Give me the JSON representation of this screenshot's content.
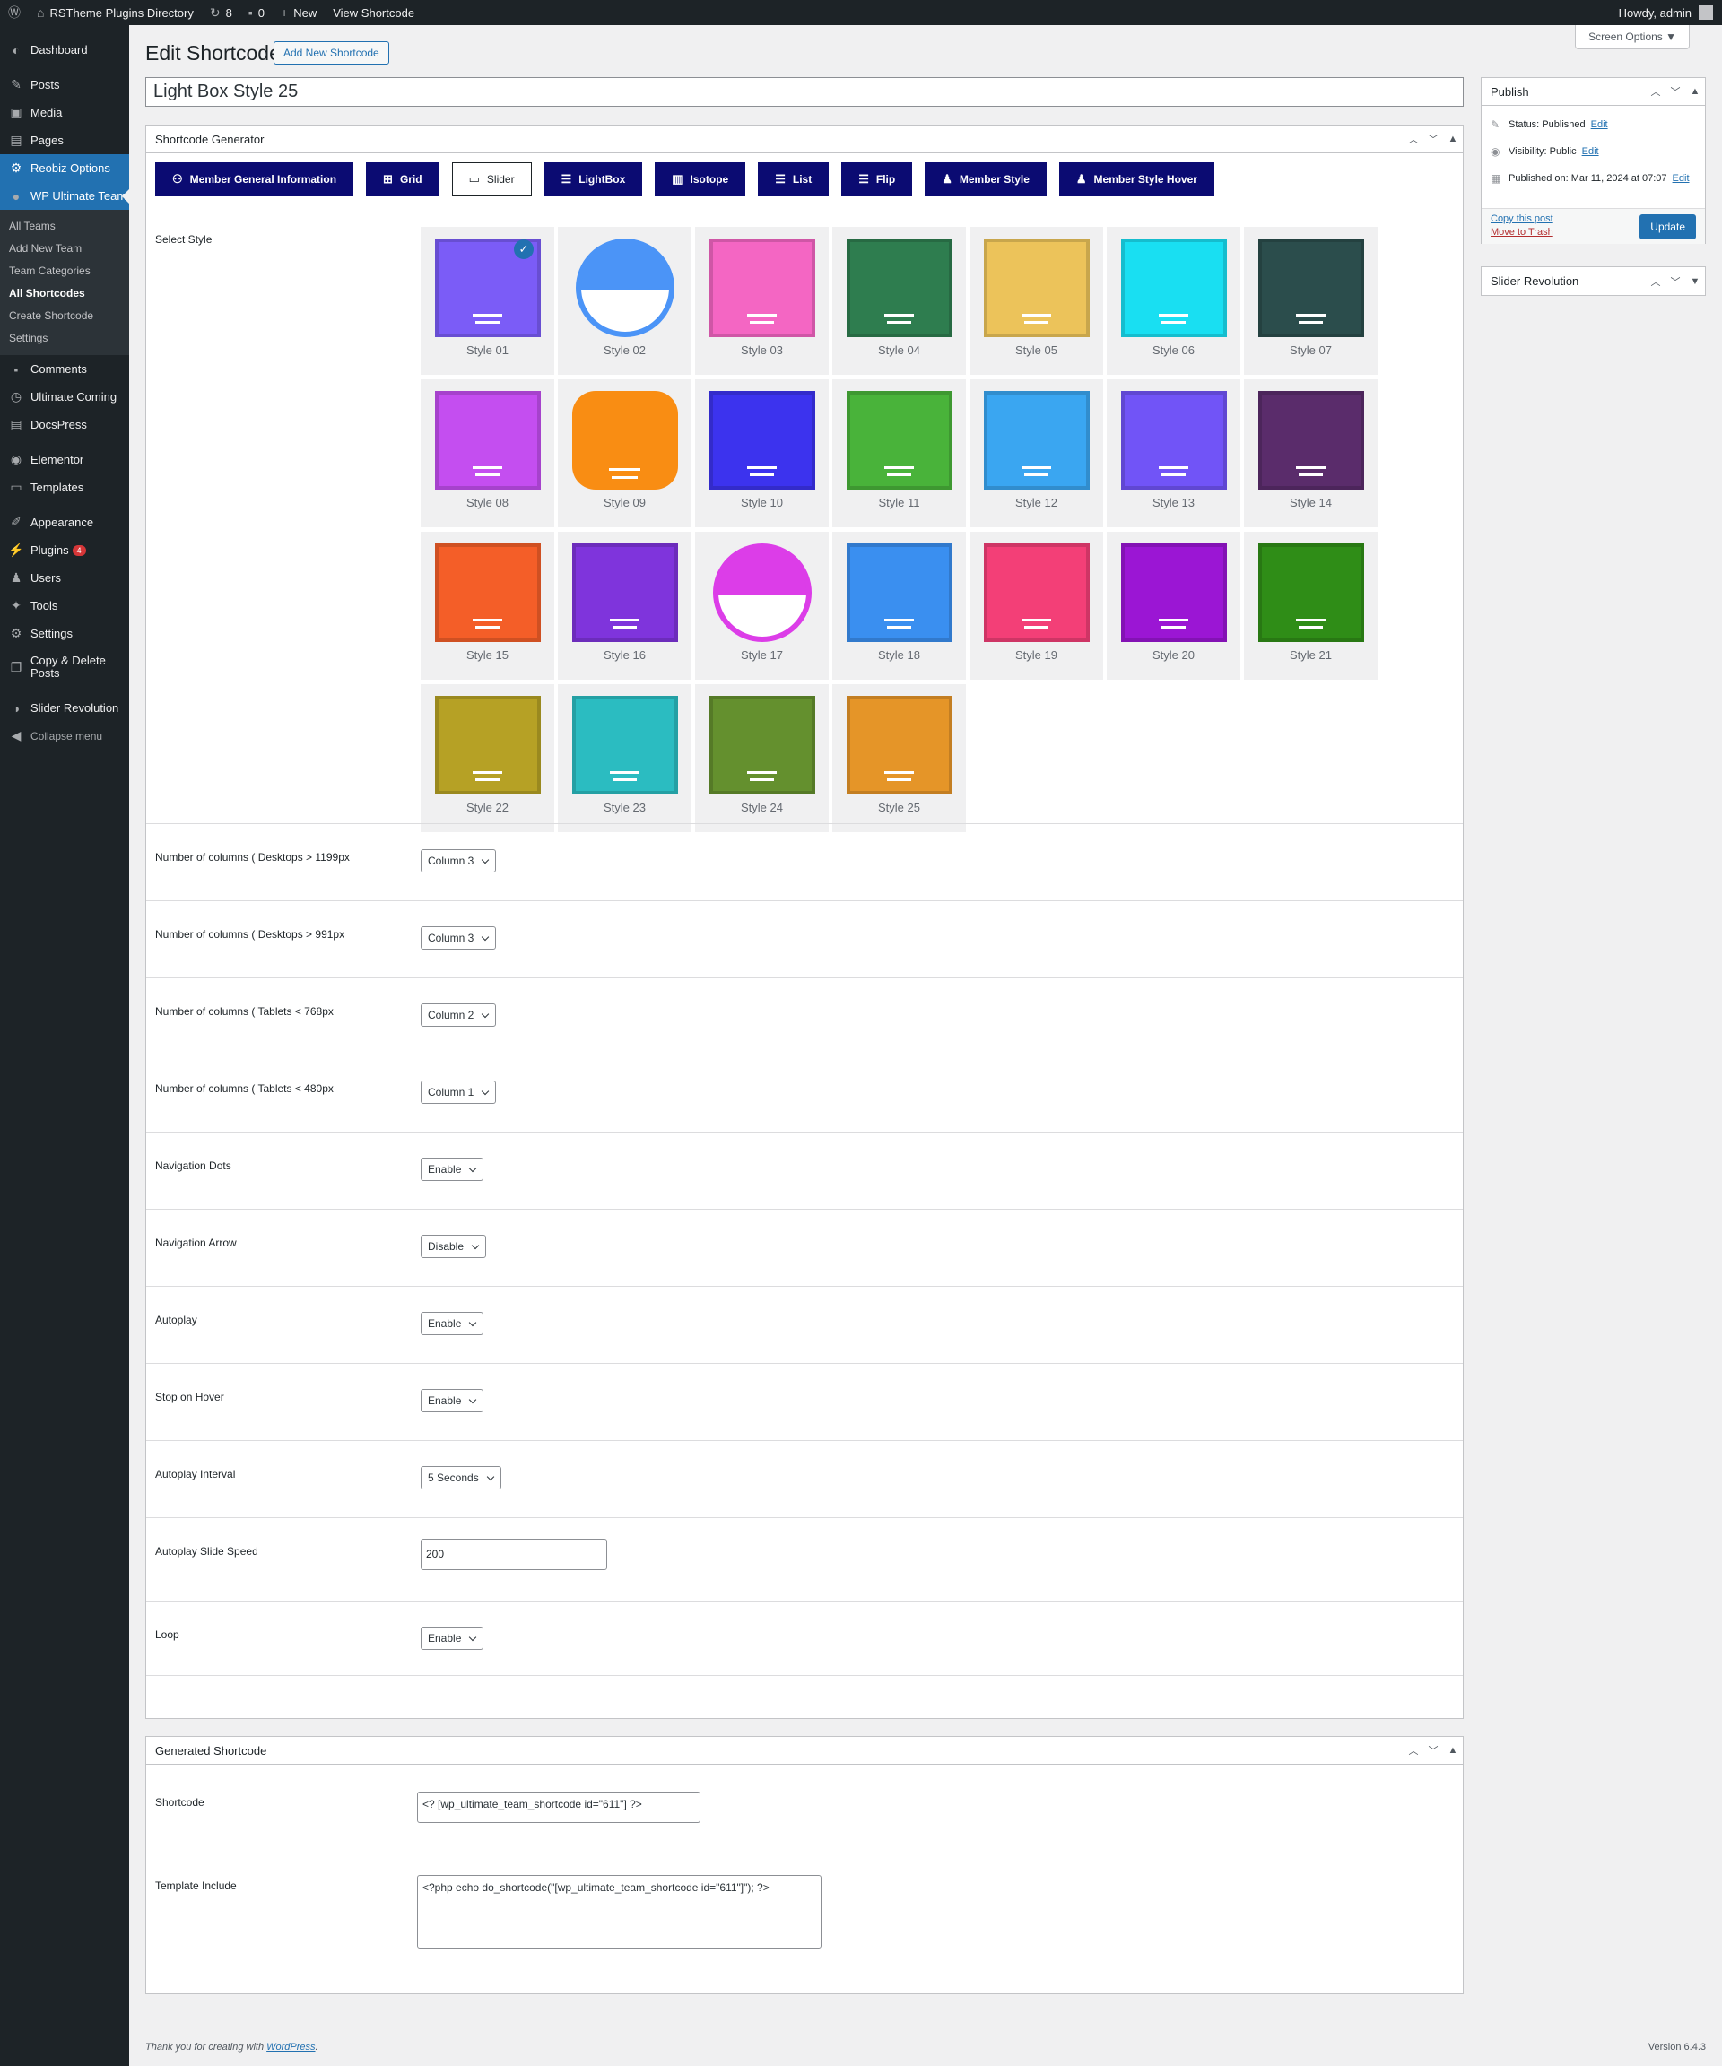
{
  "adminbar": {
    "site_name": "RSTheme Plugins Directory",
    "updates": "8",
    "comments": "0",
    "new_label": "New",
    "view_label": "View Shortcode",
    "howdy": "Howdy, admin"
  },
  "sidebar": {
    "dashboard": "Dashboard",
    "posts": "Posts",
    "media": "Media",
    "pages": "Pages",
    "reobiz": "Reobiz Options",
    "wput": "WP Ultimate Team",
    "sub": [
      "All Teams",
      "Add New Team",
      "Team Categories",
      "All Shortcodes",
      "Create Shortcode",
      "Settings"
    ],
    "comments": "Comments",
    "ultimate_coming": "Ultimate Coming",
    "docspress": "DocsPress",
    "elementor": "Elementor",
    "templates": "Templates",
    "appearance": "Appearance",
    "plugins": "Plugins",
    "plugins_badge": "4",
    "users": "Users",
    "tools": "Tools",
    "settings": "Settings",
    "copy_delete": "Copy & Delete Posts",
    "slider_rev": "Slider Revolution",
    "collapse": "Collapse menu"
  },
  "page": {
    "title": "Edit Shortcode",
    "add_new": "Add New Shortcode",
    "screen_options": "Screen Options ▼",
    "post_title": "Light Box Style 25"
  },
  "generator": {
    "title": "Shortcode Generator",
    "tabs": [
      "Member General Information",
      "Grid",
      "Slider",
      "LightBox",
      "Isotope",
      "List",
      "Flip",
      "Member Style",
      "Member Style Hover"
    ],
    "select_style_label": "Select Style",
    "styles": [
      "Style 01",
      "Style 02",
      "Style 03",
      "Style 04",
      "Style 05",
      "Style 06",
      "Style 07",
      "Style 08",
      "Style 09",
      "Style 10",
      "Style 11",
      "Style 12",
      "Style 13",
      "Style 14",
      "Style 15",
      "Style 16",
      "Style 17",
      "Style 18",
      "Style 19",
      "Style 20",
      "Style 21",
      "Style 22",
      "Style 23",
      "Style 24",
      "Style 25"
    ],
    "settings": [
      {
        "label": "Number of columns ( Desktops > 1199px",
        "value": "Column 3"
      },
      {
        "label": "Number of columns ( Desktops > 991px",
        "value": "Column 3"
      },
      {
        "label": "Number of columns ( Tablets < 768px",
        "value": "Column 2"
      },
      {
        "label": "Number of columns ( Tablets < 480px",
        "value": "Column 1"
      },
      {
        "label": "Navigation Dots",
        "value": "Enable"
      },
      {
        "label": "Navigation Arrow",
        "value": "Disable"
      },
      {
        "label": "Autoplay",
        "value": "Enable"
      },
      {
        "label": "Stop on Hover",
        "value": "Enable"
      },
      {
        "label": "Autoplay Interval",
        "value": "5 Seconds"
      },
      {
        "label": "Autoplay Slide Speed",
        "value": "200"
      },
      {
        "label": "Loop",
        "value": "Enable"
      }
    ]
  },
  "generated": {
    "title": "Generated Shortcode",
    "shortcode_label": "Shortcode",
    "shortcode_value": "<?      [wp_ultimate_team_shortcode id=\"611\"]        ?>",
    "template_label": "Template Include",
    "template_value": "<?php echo do_shortcode(\"[wp_ultimate_team_shortcode id=\"611\"]\"); ?>"
  },
  "publish": {
    "title": "Publish",
    "status": "Status: Published",
    "visibility": "Visibility: Public",
    "published_on": "Published on: Mar 11, 2024 at 07:07",
    "edit": "Edit",
    "copy": "Copy this post",
    "trash": "Move to Trash",
    "update": "Update"
  },
  "slider_revolution_box": {
    "title": "Slider Revolution"
  },
  "footer": {
    "thanks": "Thank you for creating with ",
    "wp": "WordPress",
    "version": "Version 6.4.3"
  },
  "colors": {
    "accent": "#2271b1",
    "tab": "#0b0b72",
    "style_colors": [
      "#7b5cf7",
      "#4b94f7",
      "#f466c3",
      "#2e7d4f",
      "#ecc35a",
      "#19dff2",
      "#2b4d4c",
      "#c44ef0",
      "#f98d13",
      "#3c33ee",
      "#49b33a",
      "#3aa6f1",
      "#7154f7",
      "#5a2c6b",
      "#f45e28",
      "#7f34dc",
      "#dc3de8",
      "#3a8ff0",
      "#f33f77",
      "#9b16d4",
      "#2f8d17",
      "#b6a125",
      "#2bbcc1",
      "#64902e",
      "#e59528"
    ]
  }
}
